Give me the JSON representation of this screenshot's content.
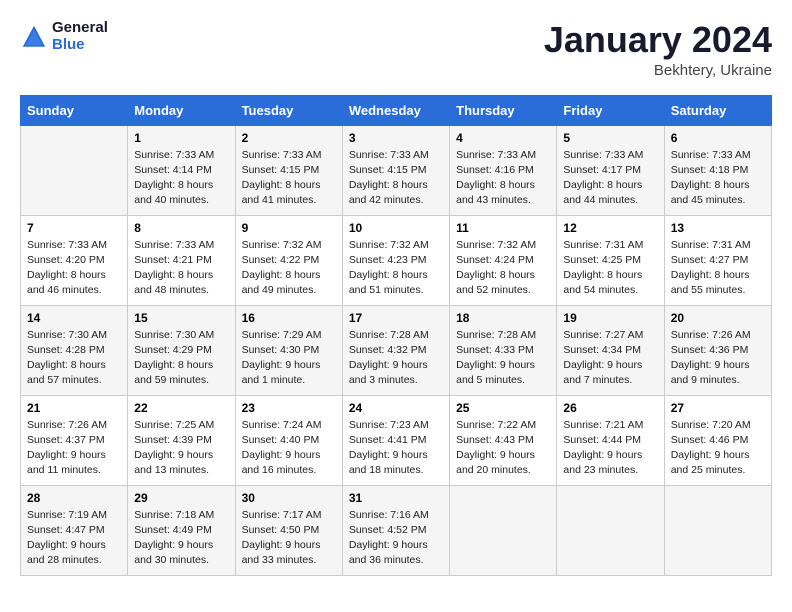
{
  "header": {
    "logo_line1": "General",
    "logo_line2": "Blue",
    "month": "January 2024",
    "location": "Bekhtery, Ukraine"
  },
  "columns": [
    "Sunday",
    "Monday",
    "Tuesday",
    "Wednesday",
    "Thursday",
    "Friday",
    "Saturday"
  ],
  "weeks": [
    [
      {
        "day": "",
        "sunrise": "",
        "sunset": "",
        "daylight": ""
      },
      {
        "day": "1",
        "sunrise": "Sunrise: 7:33 AM",
        "sunset": "Sunset: 4:14 PM",
        "daylight": "Daylight: 8 hours and 40 minutes."
      },
      {
        "day": "2",
        "sunrise": "Sunrise: 7:33 AM",
        "sunset": "Sunset: 4:15 PM",
        "daylight": "Daylight: 8 hours and 41 minutes."
      },
      {
        "day": "3",
        "sunrise": "Sunrise: 7:33 AM",
        "sunset": "Sunset: 4:15 PM",
        "daylight": "Daylight: 8 hours and 42 minutes."
      },
      {
        "day": "4",
        "sunrise": "Sunrise: 7:33 AM",
        "sunset": "Sunset: 4:16 PM",
        "daylight": "Daylight: 8 hours and 43 minutes."
      },
      {
        "day": "5",
        "sunrise": "Sunrise: 7:33 AM",
        "sunset": "Sunset: 4:17 PM",
        "daylight": "Daylight: 8 hours and 44 minutes."
      },
      {
        "day": "6",
        "sunrise": "Sunrise: 7:33 AM",
        "sunset": "Sunset: 4:18 PM",
        "daylight": "Daylight: 8 hours and 45 minutes."
      }
    ],
    [
      {
        "day": "7",
        "sunrise": "Sunrise: 7:33 AM",
        "sunset": "Sunset: 4:20 PM",
        "daylight": "Daylight: 8 hours and 46 minutes."
      },
      {
        "day": "8",
        "sunrise": "Sunrise: 7:33 AM",
        "sunset": "Sunset: 4:21 PM",
        "daylight": "Daylight: 8 hours and 48 minutes."
      },
      {
        "day": "9",
        "sunrise": "Sunrise: 7:32 AM",
        "sunset": "Sunset: 4:22 PM",
        "daylight": "Daylight: 8 hours and 49 minutes."
      },
      {
        "day": "10",
        "sunrise": "Sunrise: 7:32 AM",
        "sunset": "Sunset: 4:23 PM",
        "daylight": "Daylight: 8 hours and 51 minutes."
      },
      {
        "day": "11",
        "sunrise": "Sunrise: 7:32 AM",
        "sunset": "Sunset: 4:24 PM",
        "daylight": "Daylight: 8 hours and 52 minutes."
      },
      {
        "day": "12",
        "sunrise": "Sunrise: 7:31 AM",
        "sunset": "Sunset: 4:25 PM",
        "daylight": "Daylight: 8 hours and 54 minutes."
      },
      {
        "day": "13",
        "sunrise": "Sunrise: 7:31 AM",
        "sunset": "Sunset: 4:27 PM",
        "daylight": "Daylight: 8 hours and 55 minutes."
      }
    ],
    [
      {
        "day": "14",
        "sunrise": "Sunrise: 7:30 AM",
        "sunset": "Sunset: 4:28 PM",
        "daylight": "Daylight: 8 hours and 57 minutes."
      },
      {
        "day": "15",
        "sunrise": "Sunrise: 7:30 AM",
        "sunset": "Sunset: 4:29 PM",
        "daylight": "Daylight: 8 hours and 59 minutes."
      },
      {
        "day": "16",
        "sunrise": "Sunrise: 7:29 AM",
        "sunset": "Sunset: 4:30 PM",
        "daylight": "Daylight: 9 hours and 1 minute."
      },
      {
        "day": "17",
        "sunrise": "Sunrise: 7:28 AM",
        "sunset": "Sunset: 4:32 PM",
        "daylight": "Daylight: 9 hours and 3 minutes."
      },
      {
        "day": "18",
        "sunrise": "Sunrise: 7:28 AM",
        "sunset": "Sunset: 4:33 PM",
        "daylight": "Daylight: 9 hours and 5 minutes."
      },
      {
        "day": "19",
        "sunrise": "Sunrise: 7:27 AM",
        "sunset": "Sunset: 4:34 PM",
        "daylight": "Daylight: 9 hours and 7 minutes."
      },
      {
        "day": "20",
        "sunrise": "Sunrise: 7:26 AM",
        "sunset": "Sunset: 4:36 PM",
        "daylight": "Daylight: 9 hours and 9 minutes."
      }
    ],
    [
      {
        "day": "21",
        "sunrise": "Sunrise: 7:26 AM",
        "sunset": "Sunset: 4:37 PM",
        "daylight": "Daylight: 9 hours and 11 minutes."
      },
      {
        "day": "22",
        "sunrise": "Sunrise: 7:25 AM",
        "sunset": "Sunset: 4:39 PM",
        "daylight": "Daylight: 9 hours and 13 minutes."
      },
      {
        "day": "23",
        "sunrise": "Sunrise: 7:24 AM",
        "sunset": "Sunset: 4:40 PM",
        "daylight": "Daylight: 9 hours and 16 minutes."
      },
      {
        "day": "24",
        "sunrise": "Sunrise: 7:23 AM",
        "sunset": "Sunset: 4:41 PM",
        "daylight": "Daylight: 9 hours and 18 minutes."
      },
      {
        "day": "25",
        "sunrise": "Sunrise: 7:22 AM",
        "sunset": "Sunset: 4:43 PM",
        "daylight": "Daylight: 9 hours and 20 minutes."
      },
      {
        "day": "26",
        "sunrise": "Sunrise: 7:21 AM",
        "sunset": "Sunset: 4:44 PM",
        "daylight": "Daylight: 9 hours and 23 minutes."
      },
      {
        "day": "27",
        "sunrise": "Sunrise: 7:20 AM",
        "sunset": "Sunset: 4:46 PM",
        "daylight": "Daylight: 9 hours and 25 minutes."
      }
    ],
    [
      {
        "day": "28",
        "sunrise": "Sunrise: 7:19 AM",
        "sunset": "Sunset: 4:47 PM",
        "daylight": "Daylight: 9 hours and 28 minutes."
      },
      {
        "day": "29",
        "sunrise": "Sunrise: 7:18 AM",
        "sunset": "Sunset: 4:49 PM",
        "daylight": "Daylight: 9 hours and 30 minutes."
      },
      {
        "day": "30",
        "sunrise": "Sunrise: 7:17 AM",
        "sunset": "Sunset: 4:50 PM",
        "daylight": "Daylight: 9 hours and 33 minutes."
      },
      {
        "day": "31",
        "sunrise": "Sunrise: 7:16 AM",
        "sunset": "Sunset: 4:52 PM",
        "daylight": "Daylight: 9 hours and 36 minutes."
      },
      {
        "day": "",
        "sunrise": "",
        "sunset": "",
        "daylight": ""
      },
      {
        "day": "",
        "sunrise": "",
        "sunset": "",
        "daylight": ""
      },
      {
        "day": "",
        "sunrise": "",
        "sunset": "",
        "daylight": ""
      }
    ]
  ]
}
